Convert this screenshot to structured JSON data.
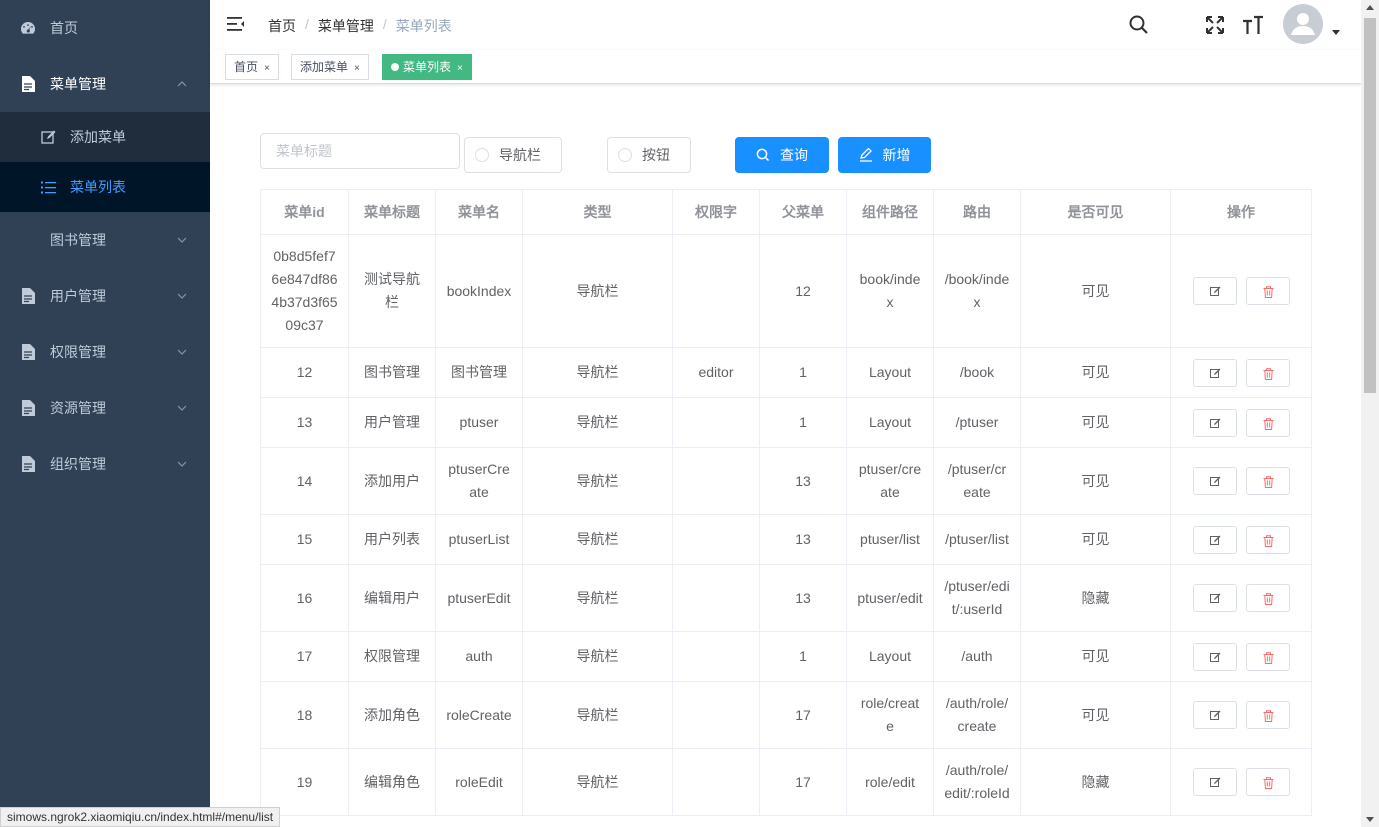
{
  "sidebar": {
    "items": [
      {
        "label": "首页",
        "icon": "dashboard-icon"
      },
      {
        "label": "菜单管理",
        "icon": "document-icon",
        "open": true,
        "children": [
          {
            "label": "添加菜单",
            "icon": "edit-icon",
            "active": false
          },
          {
            "label": "菜单列表",
            "icon": "list-icon",
            "active": true
          }
        ]
      },
      {
        "label": "图书管理"
      },
      {
        "label": "用户管理",
        "icon": "document-icon"
      },
      {
        "label": "权限管理",
        "icon": "document-icon"
      },
      {
        "label": "资源管理",
        "icon": "document-icon"
      },
      {
        "label": "组织管理",
        "icon": "document-icon"
      }
    ]
  },
  "header": {
    "breadcrumb": [
      "首页",
      "菜单管理",
      "菜单列表"
    ]
  },
  "tags": [
    {
      "label": "首页",
      "close": "×",
      "active": false
    },
    {
      "label": "添加菜单",
      "close": "×",
      "active": false
    },
    {
      "label": "菜单列表",
      "close": "×",
      "active": true
    }
  ],
  "filter": {
    "title_placeholder": "菜单标题",
    "radio_nav": "导航栏",
    "radio_button": "按钮",
    "query_label": "查询",
    "add_label": "新增"
  },
  "table": {
    "headers": [
      "菜单id",
      "菜单标题",
      "菜单名",
      "类型",
      "权限字",
      "父菜单",
      "组件路径",
      "路由",
      "是否可见",
      "操作"
    ],
    "rows": [
      {
        "id": "0b8d5fef76e847df864b37d3f6509c37",
        "title": "测试导航栏",
        "name": "bookIndex",
        "type": "导航栏",
        "perm": "",
        "parent": "12",
        "component": "book/index",
        "route": "/book/index",
        "visible": "可见"
      },
      {
        "id": "12",
        "title": "图书管理",
        "name": "图书管理",
        "type": "导航栏",
        "perm": "editor",
        "parent": "1",
        "component": "Layout",
        "route": "/book",
        "visible": "可见"
      },
      {
        "id": "13",
        "title": "用户管理",
        "name": "ptuser",
        "type": "导航栏",
        "perm": "",
        "parent": "1",
        "component": "Layout",
        "route": "/ptuser",
        "visible": "可见"
      },
      {
        "id": "14",
        "title": "添加用户",
        "name": "ptuserCreate",
        "type": "导航栏",
        "perm": "",
        "parent": "13",
        "component": "ptuser/create",
        "route": "/ptuser/create",
        "visible": "可见"
      },
      {
        "id": "15",
        "title": "用户列表",
        "name": "ptuserList",
        "type": "导航栏",
        "perm": "",
        "parent": "13",
        "component": "ptuser/list",
        "route": "/ptuser/list",
        "visible": "可见"
      },
      {
        "id": "16",
        "title": "编辑用户",
        "name": "ptuserEdit",
        "type": "导航栏",
        "perm": "",
        "parent": "13",
        "component": "ptuser/edit",
        "route": "/ptuser/edit/:userId",
        "visible": "隐藏"
      },
      {
        "id": "17",
        "title": "权限管理",
        "name": "auth",
        "type": "导航栏",
        "perm": "",
        "parent": "1",
        "component": "Layout",
        "route": "/auth",
        "visible": "可见"
      },
      {
        "id": "18",
        "title": "添加角色",
        "name": "roleCreate",
        "type": "导航栏",
        "perm": "",
        "parent": "17",
        "component": "role/create",
        "route": "/auth/role/create",
        "visible": "可见"
      },
      {
        "id": "19",
        "title": "编辑角色",
        "name": "roleEdit",
        "type": "导航栏",
        "perm": "",
        "parent": "17",
        "component": "role/edit",
        "route": "/auth/role/edit/:roleId",
        "visible": "隐藏"
      }
    ]
  },
  "statusbar": {
    "url": "simows.ngrok2.xiaomiqiu.cn/index.html#/menu/list"
  },
  "colors": {
    "sidebar_bg": "#304156",
    "active_text": "#409eff",
    "primary": "#1890ff",
    "tag_active": "#42b983",
    "danger": "#f56c6c"
  }
}
